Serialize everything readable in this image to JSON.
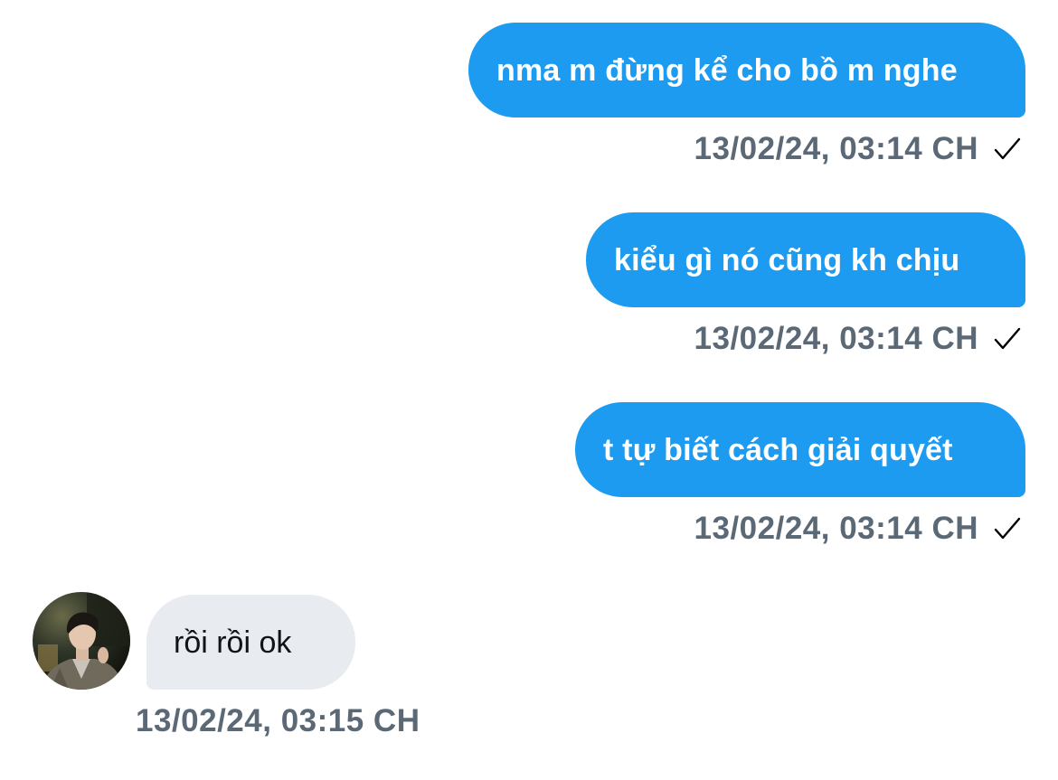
{
  "conversation": {
    "messages": [
      {
        "direction": "sent",
        "text": "nma m đừng kể cho bồ m nghe",
        "timestamp": "13/02/24, 03:14 CH",
        "status_icon": "checkmark-icon"
      },
      {
        "direction": "sent",
        "text": "kiểu gì nó cũng kh chịu",
        "timestamp": "13/02/24, 03:14 CH",
        "status_icon": "checkmark-icon"
      },
      {
        "direction": "sent",
        "text": "t tự biết cách giải quyết",
        "timestamp": "13/02/24, 03:14 CH",
        "status_icon": "checkmark-icon"
      },
      {
        "direction": "received",
        "text": "rồi rồi ok",
        "timestamp": "13/02/24, 03:15 CH",
        "avatar": "avatar-photo"
      }
    ]
  },
  "colors": {
    "sent_bubble": "#1d9bf0",
    "received_bubble": "#e8ebef",
    "timestamp_text": "#5b6876",
    "background": "#ffffff"
  }
}
